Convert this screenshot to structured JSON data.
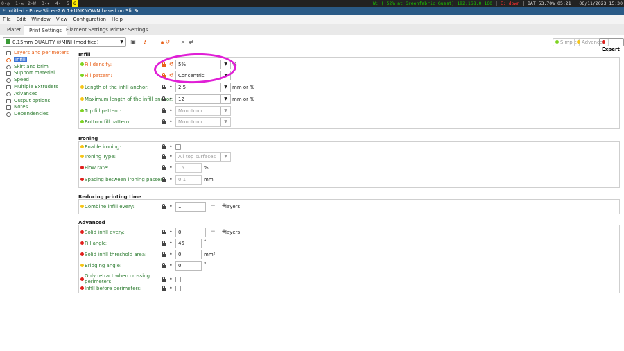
{
  "status_bar": {
    "workspaces": [
      "0-◔",
      "1-✉",
      "2-W",
      "3-✦",
      "4-",
      "5",
      "6"
    ],
    "active_workspace": "6",
    "wifi": "W: ( 52% at Greenfabric_Guest) 192.168.0.160",
    "ethernet": "E: down",
    "battery": "BAT 53.70% 05:21",
    "datetime": "06/11/2023 15:30"
  },
  "window": {
    "title": "*Untitled - PrusaSlicer-2.6.1+UNKNOWN based on Slic3r"
  },
  "menu": [
    "File",
    "Edit",
    "Window",
    "View",
    "Configuration",
    "Help"
  ],
  "tabs": [
    "Plater",
    "Print Settings",
    "Filament Settings",
    "Printer Settings"
  ],
  "active_tab": "Print Settings",
  "toolbar": {
    "preset": "0.15mm QUALITY @MINI (modified)",
    "modes": [
      "Simple",
      "Advanced",
      "Expert"
    ],
    "selected_mode": "Expert"
  },
  "sidebar": [
    {
      "label": "Layers and perimeters",
      "modified": true
    },
    {
      "label": "Infill",
      "selected": true
    },
    {
      "label": "Skirt and brim"
    },
    {
      "label": "Support material"
    },
    {
      "label": "Speed"
    },
    {
      "label": "Multiple Extruders"
    },
    {
      "label": "Advanced"
    },
    {
      "label": "Output options"
    },
    {
      "label": "Notes"
    },
    {
      "label": "Dependencies"
    }
  ],
  "groups": {
    "infill": "Infill",
    "ironing": "Ironing",
    "reducing": "Reducing printing time",
    "advanced": "Advanced"
  },
  "settings": {
    "fill_density": {
      "label": "Fill density:",
      "value": "5%",
      "unit": "%"
    },
    "fill_pattern": {
      "label": "Fill pattern:",
      "value": "Concentric"
    },
    "infill_anchor": {
      "label": "Length of the infill anchor:",
      "value": "2.5",
      "unit": "mm or %"
    },
    "infill_anchor_max": {
      "label": "Maximum length of the infill anchor:",
      "value": "12",
      "unit": "mm or %"
    },
    "top_fill_pattern": {
      "label": "Top fill pattern:",
      "value": "Monotonic"
    },
    "bottom_fill_pattern": {
      "label": "Bottom fill pattern:",
      "value": "Monotonic"
    },
    "ironing": {
      "label": "Enable ironing:"
    },
    "ironing_type": {
      "label": "Ironing Type:",
      "value": "All top surfaces"
    },
    "ironing_flowrate": {
      "label": "Flow rate:",
      "value": "15",
      "unit": "%"
    },
    "ironing_spacing": {
      "label": "Spacing between ironing passes:",
      "value": "0.1",
      "unit": "mm"
    },
    "infill_every_layers": {
      "label": "Combine infill every:",
      "value": "1",
      "unit": "layers"
    },
    "solid_infill_every_layers": {
      "label": "Solid infill every:",
      "value": "0",
      "unit": "layers"
    },
    "fill_angle": {
      "label": "Fill angle:",
      "value": "45",
      "unit": "°"
    },
    "solid_infill_below_area": {
      "label": "Solid infill threshold area:",
      "value": "0",
      "unit": "mm²"
    },
    "bridge_angle": {
      "label": "Bridging angle:",
      "value": "0",
      "unit": "°"
    },
    "only_retract_when_crossing_perimeters": {
      "label": "Only retract when crossing perimeters:"
    },
    "infill_first": {
      "label": "Infill before perimeters:"
    }
  },
  "colors": {
    "simple": "#7ed321",
    "advanced": "#f5c518",
    "expert": "#e0201d",
    "annotation": "#e01fd6"
  }
}
